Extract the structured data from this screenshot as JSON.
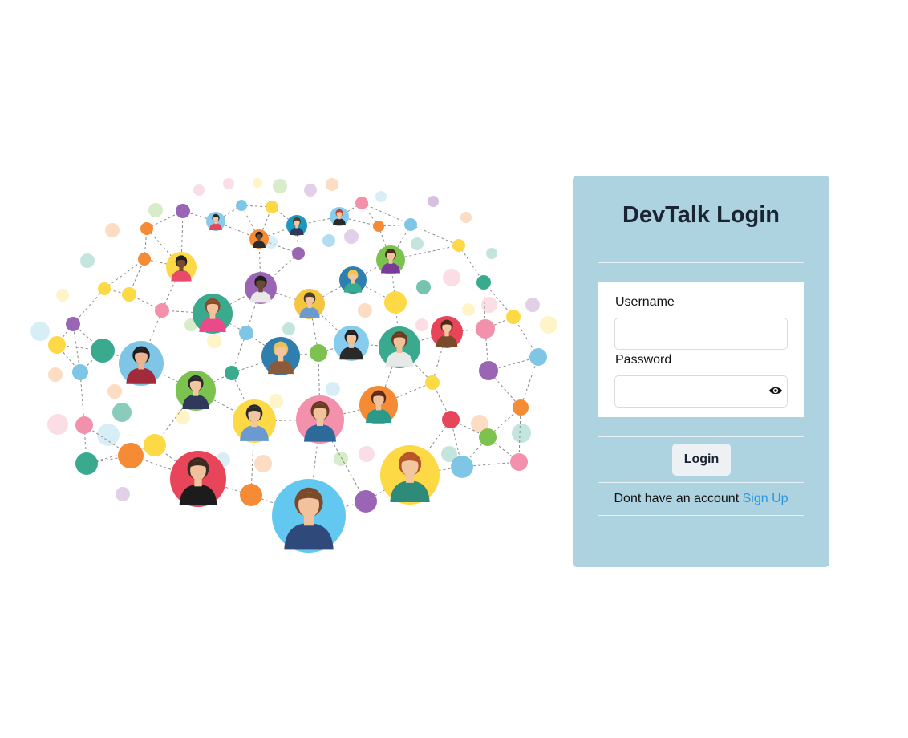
{
  "illustration": {
    "icon": "people-network-illustration"
  },
  "login": {
    "title": "DevTalk Login",
    "username_label": "Username",
    "username_value": "",
    "password_label": "Password",
    "password_value": "",
    "show_password_icon": "eye-icon",
    "button_label": "Login",
    "signup_prompt": "Dont have an account",
    "signup_link": "Sign Up"
  },
  "colors": {
    "card_background": "#add3e1",
    "title_text": "#1b2433",
    "link": "#2b96e0",
    "button_background": "#edf1f4"
  }
}
